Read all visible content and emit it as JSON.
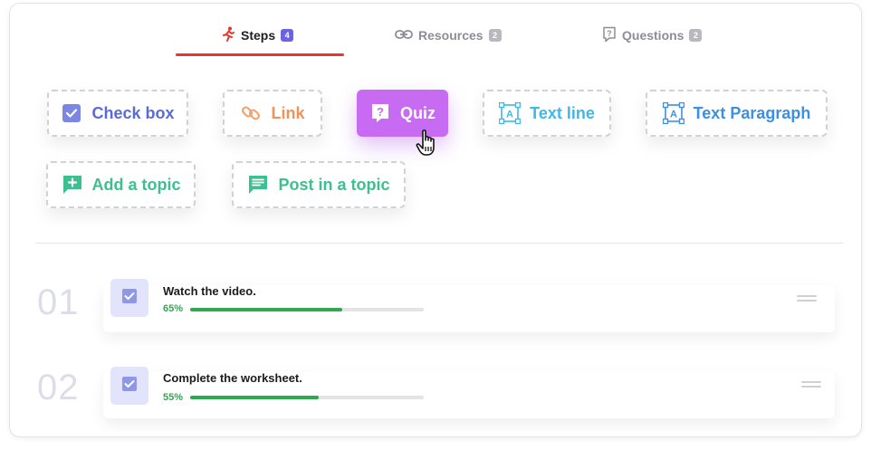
{
  "tabs": [
    {
      "label": "Steps",
      "count": "4",
      "icon": "running-person-icon",
      "active": true
    },
    {
      "label": "Resources",
      "count": "2",
      "icon": "link-icon",
      "active": false
    },
    {
      "label": "Questions",
      "count": "2",
      "icon": "question-icon",
      "active": false
    }
  ],
  "tools": {
    "checkbox": {
      "label": "Check box",
      "icon": "checkbox-icon",
      "color": "#5b6bd6"
    },
    "link": {
      "label": "Link",
      "icon": "chain-link-icon",
      "color": "#f0935a"
    },
    "quiz": {
      "label": "Quiz",
      "icon": "quiz-icon",
      "color": "#c86bf3"
    },
    "textline": {
      "label": "Text line",
      "icon": "text-frame-icon",
      "color": "#3fb8e8"
    },
    "textparagraph": {
      "label": "Text Paragraph",
      "icon": "text-frame-icon",
      "color": "#3d8fe0"
    },
    "addtopic": {
      "label": "Add a topic",
      "icon": "add-comment-icon",
      "color": "#3dbf8f"
    },
    "posttopic": {
      "label": "Post in a topic",
      "icon": "comment-icon",
      "color": "#3dbf8f"
    }
  },
  "steps": [
    {
      "number": "01",
      "title": "Watch the video.",
      "progress": "65%",
      "progress_value": 0.65
    },
    {
      "number": "02",
      "title": "Complete the worksheet.",
      "progress": "55%",
      "progress_value": 0.55
    }
  ],
  "accent": "#e5372f",
  "progress_color": "#2fa84f"
}
